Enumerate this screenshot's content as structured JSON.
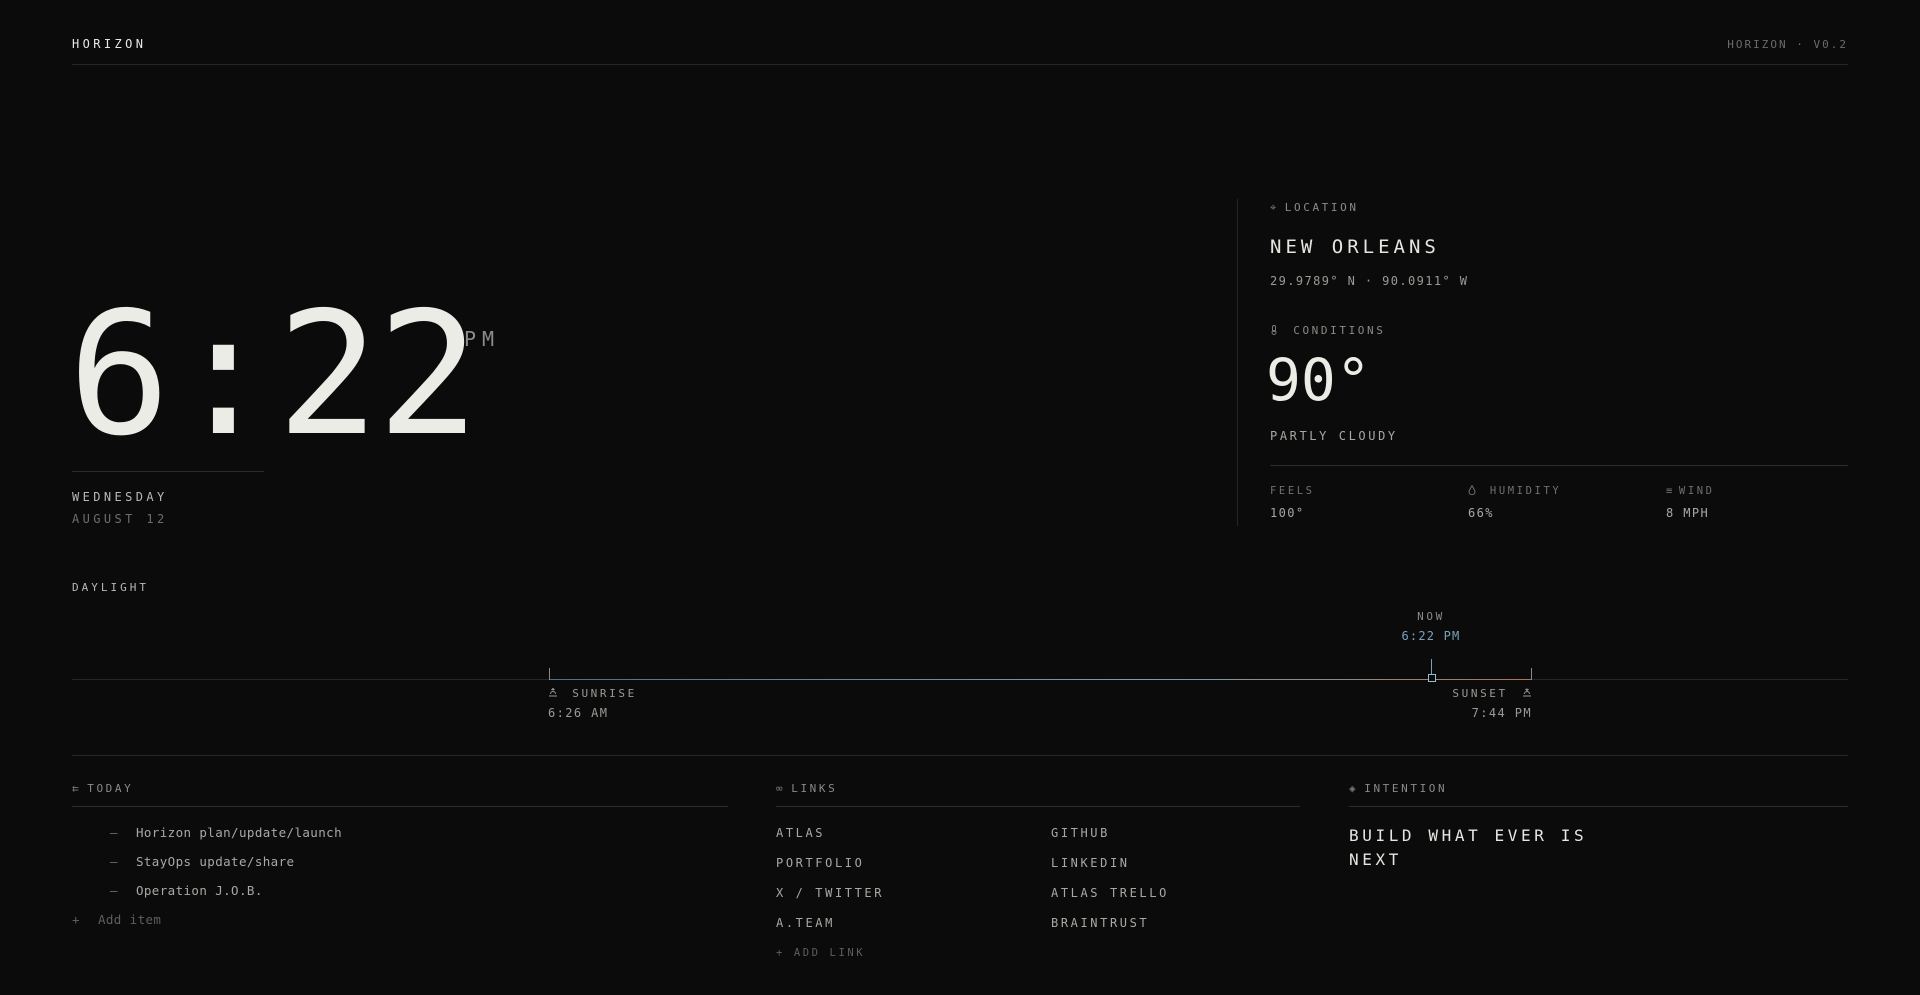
{
  "header": {
    "brand": "HORIZON",
    "version": "HORIZON · V0.2"
  },
  "clock": {
    "hours": "6",
    "minutes": "22",
    "ampm": "PM",
    "day": "WEDNESDAY",
    "date": "AUGUST 12"
  },
  "location": {
    "label": "LOCATION",
    "city": "NEW ORLEANS",
    "coords": "29.9789° N · 90.0911° W"
  },
  "conditions": {
    "label": "CONDITIONS",
    "temp": "90°",
    "summary": "PARTLY CLOUDY",
    "feels_label": "FEELS",
    "feels_value": "100°",
    "humidity_label": "HUMIDITY",
    "humidity_value": "66%",
    "wind_label": "WIND",
    "wind_value": "8 MPH"
  },
  "daylight": {
    "label": "DAYLIGHT",
    "now_label": "NOW",
    "now_time": "6:22 PM",
    "sunrise_label": "SUNRISE",
    "sunrise_time": "6:26 AM",
    "sunset_label": "SUNSET",
    "sunset_time": "7:44 PM"
  },
  "today": {
    "title": "TODAY",
    "items": [
      "Horizon plan/update/launch",
      "StayOps update/share",
      "Operation J.O.B."
    ],
    "add_label": "Add item"
  },
  "links": {
    "title": "LINKS",
    "items": [
      "ATLAS",
      "GITHUB",
      "PORTFOLIO",
      "LINKEDIN",
      "X / TWITTER",
      "ATLAS TRELLO",
      "A.TEAM",
      "BRAINTRUST"
    ],
    "add_label": "+ ADD LINK"
  },
  "intention": {
    "title": "INTENTION",
    "text": "BUILD WHAT EVER IS NEXT"
  },
  "icons": {
    "location": "crosshair-icon",
    "conditions": "thermometer-icon",
    "humidity": "droplet-icon",
    "wind": "wind-icon",
    "sunrise": "sunrise-icon",
    "sunset": "sunset-icon",
    "today": "list-icon",
    "links": "link-icon",
    "intention": "diamond-icon"
  },
  "colors": {
    "background": "#0b0b0b",
    "accent_now": "#7aa0bd",
    "sunset_warm": "#b07055"
  }
}
